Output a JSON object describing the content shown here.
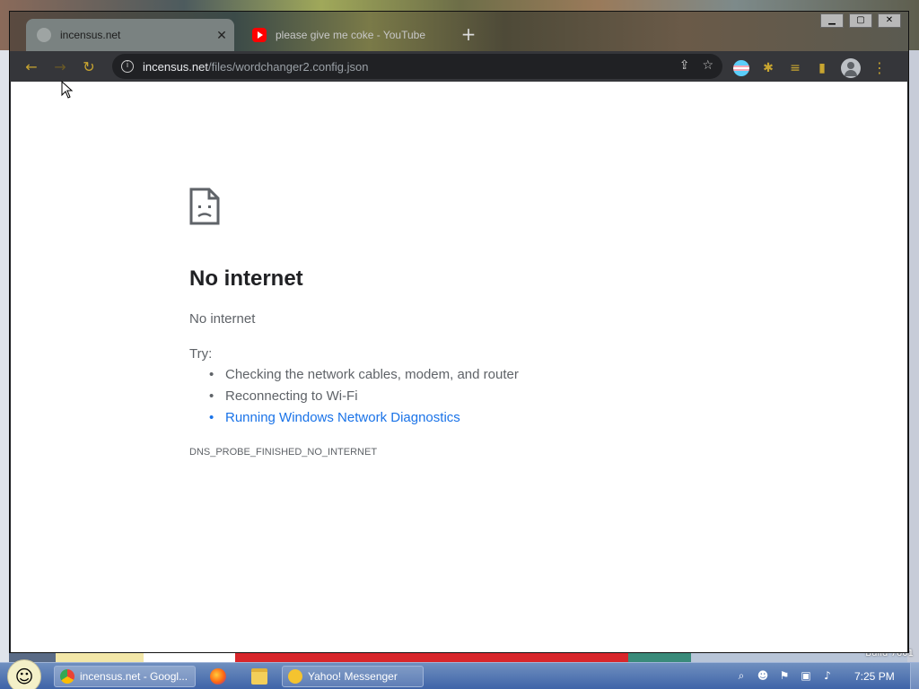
{
  "desktop": {
    "build_text": "Build 7601"
  },
  "browser": {
    "tabs": [
      {
        "title": "incensus.net",
        "active": true
      },
      {
        "title": "please give me coke - YouTube",
        "active": false
      }
    ],
    "new_tab_symbol": "+",
    "tab_close_symbol": "✕",
    "window_controls": {
      "minimize": "▁",
      "maximize": "▢",
      "close": "✕"
    },
    "toolbar": {
      "back_icon": "←",
      "forward_icon": "→",
      "reload_icon": "↻",
      "url_host": "incensus.net",
      "url_path": "/files/wordchanger2.config.json",
      "share_icon": "⇪",
      "bookmark_icon": "☆"
    },
    "extensions": {
      "puzzle_icon": "✱",
      "queue_icon": "≡",
      "panel_icon": "▮",
      "menu_icon": "⋮"
    }
  },
  "error_page": {
    "title": "No internet",
    "subtitle": "No internet",
    "try_label": "Try:",
    "suggestions": [
      "Checking the network cables, modem, and router",
      "Reconnecting to Wi-Fi",
      "Running Windows Network Diagnostics"
    ],
    "error_code": "DNS_PROBE_FINISHED_NO_INTERNET",
    "link_color": "#1a73e8"
  },
  "taskbar": {
    "start_icon": "☺",
    "buttons": [
      {
        "label": "incensus.net - Googl..."
      },
      {
        "label": "Yahoo! Messenger"
      }
    ],
    "tray_icons": [
      "⌕",
      "☻",
      "⚑",
      "▣",
      "♪"
    ],
    "clock": "7:25 PM"
  }
}
